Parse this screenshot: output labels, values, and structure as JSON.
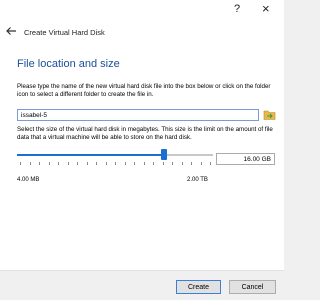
{
  "window": {
    "help_label": "?",
    "close_label": "×"
  },
  "dialog": {
    "title": "Create Virtual Hard Disk",
    "back_icon": "back-arrow-icon"
  },
  "section": {
    "heading": "File location and size",
    "file_description": "Please type the name of the new virtual hard disk file into the box below or click on the folder icon to select a different folder to create the file in.",
    "file_name": "issabel-5",
    "folder_icon": "folder-icon",
    "size_description": "Select the size of the virtual hard disk in megabytes. This size is the limit on the amount of file data that a virtual machine will be able to store on the hard disk.",
    "size_value": "16.00 GB",
    "size_slider_fraction": 0.76,
    "size_min_label": "4.00 MB",
    "size_max_label": "2.00 TB"
  },
  "buttons": {
    "create_label": "Create",
    "cancel_label": "Cancel"
  },
  "colors": {
    "heading": "#1a4f99",
    "slider_accent": "#1a6fd0",
    "folder_icon_fill": "#e8b94a",
    "folder_icon_arrow": "#3a9a3a"
  }
}
